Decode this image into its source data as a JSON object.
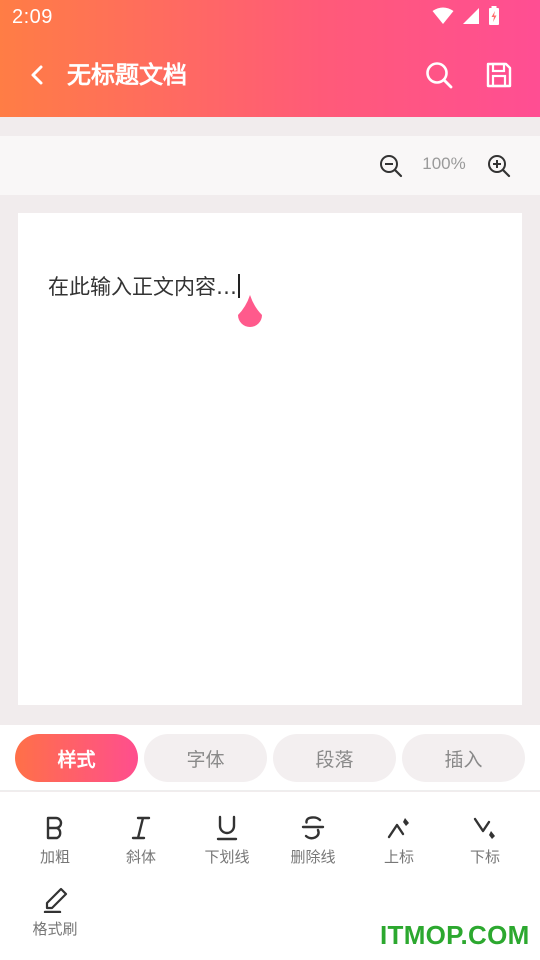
{
  "status_bar": {
    "time": "2:09"
  },
  "appbar": {
    "title": "无标题文档"
  },
  "zoom": {
    "level": "100%"
  },
  "editor": {
    "placeholder_text": "在此输入正文内容…"
  },
  "tabs": [
    {
      "label": "样式",
      "active": true
    },
    {
      "label": "字体",
      "active": false
    },
    {
      "label": "段落",
      "active": false
    },
    {
      "label": "插入",
      "active": false
    }
  ],
  "toolbar": {
    "items": [
      {
        "label": "加粗",
        "icon": "bold-icon"
      },
      {
        "label": "斜体",
        "icon": "italic-icon"
      },
      {
        "label": "下划线",
        "icon": "underline-icon"
      },
      {
        "label": "删除线",
        "icon": "strikethrough-icon"
      },
      {
        "label": "上标",
        "icon": "superscript-icon"
      },
      {
        "label": "下标",
        "icon": "subscript-icon"
      },
      {
        "label": "格式刷",
        "icon": "format-painter-icon"
      }
    ]
  },
  "watermark": {
    "text": "ITMOP.COM"
  },
  "colors": {
    "accent_start": "#ff7d45",
    "accent_end": "#ff4e93",
    "caret_handle": "#ff5a8c",
    "watermark": "#2ca82f"
  }
}
